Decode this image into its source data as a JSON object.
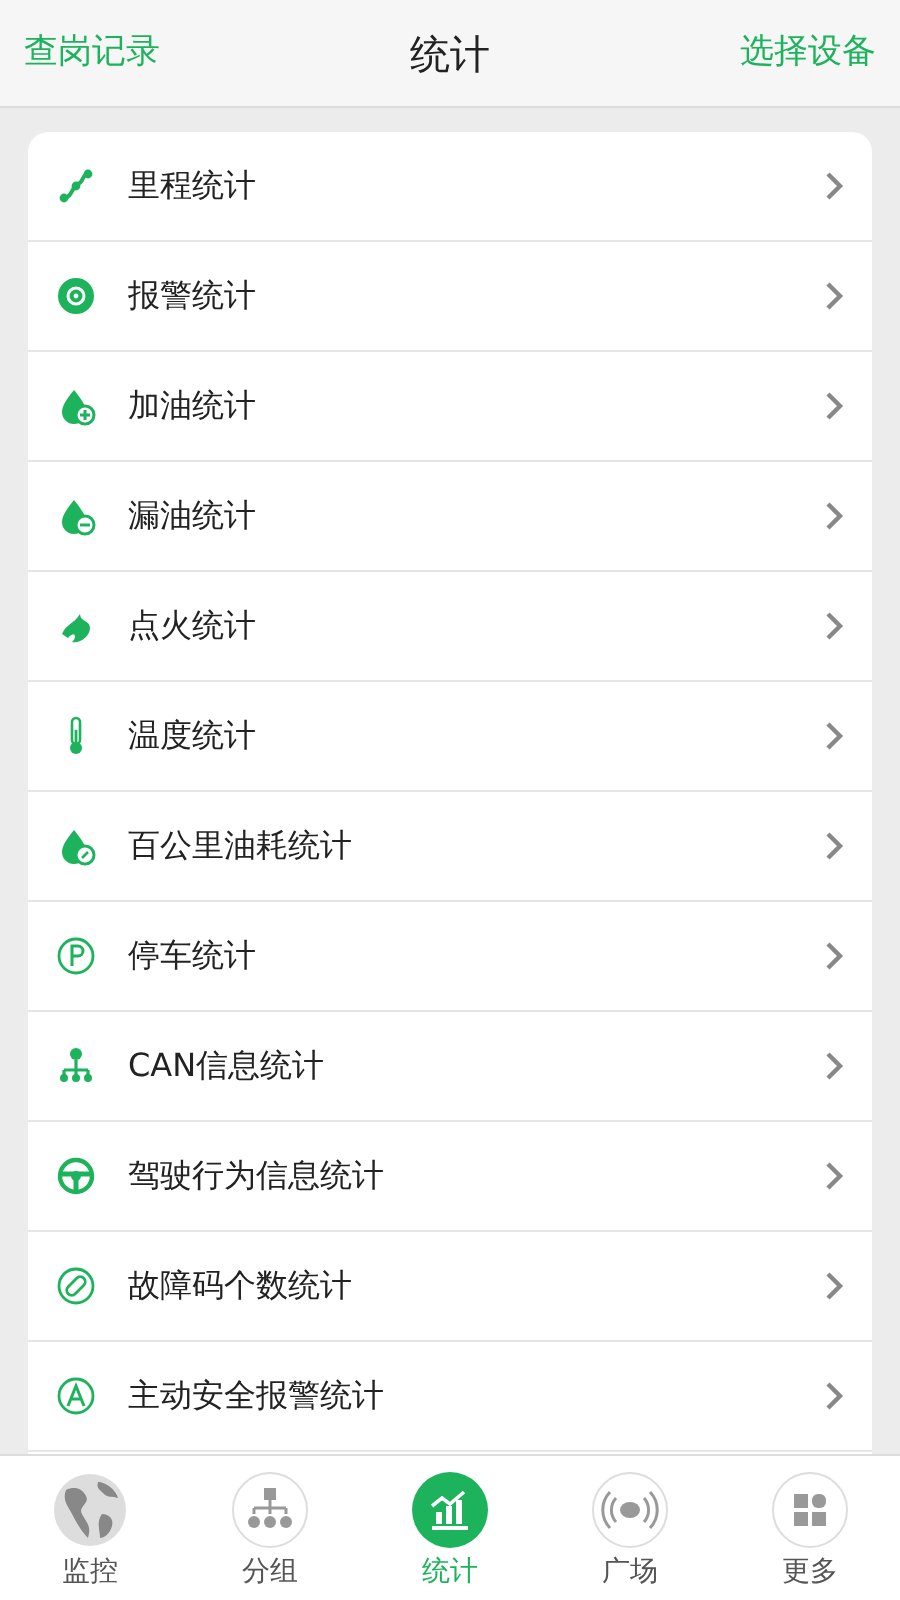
{
  "header": {
    "left_link": "查岗记录",
    "title": "统计",
    "right_link": "选择设备"
  },
  "items": [
    {
      "label": "里程统计"
    },
    {
      "label": "报警统计"
    },
    {
      "label": "加油统计"
    },
    {
      "label": "漏油统计"
    },
    {
      "label": "点火统计"
    },
    {
      "label": "温度统计"
    },
    {
      "label": "百公里油耗统计"
    },
    {
      "label": "停车统计"
    },
    {
      "label": "CAN信息统计"
    },
    {
      "label": "驾驶行为信息统计"
    },
    {
      "label": "故障码个数统计"
    },
    {
      "label": "主动安全报警统计"
    }
  ],
  "tabs": [
    {
      "label": "监控",
      "selected": false
    },
    {
      "label": "分组",
      "selected": false
    },
    {
      "label": "统计",
      "selected": true
    },
    {
      "label": "广场",
      "selected": false
    },
    {
      "label": "更多",
      "selected": false
    }
  ]
}
